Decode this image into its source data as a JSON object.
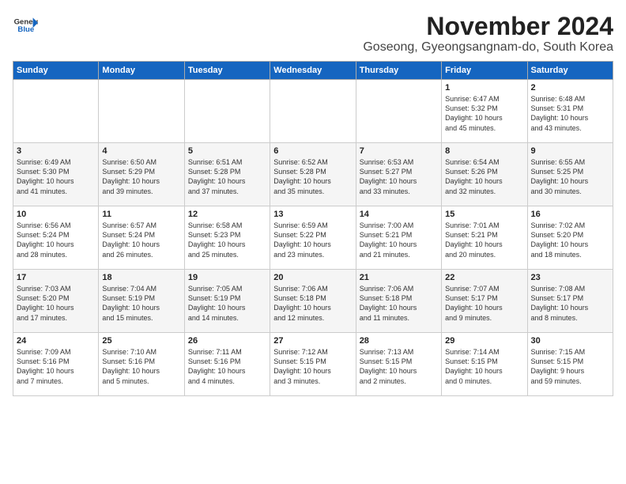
{
  "logo": {
    "line1": "General",
    "line2": "Blue"
  },
  "header": {
    "month": "November 2024",
    "location": "Goseong, Gyeongsangnam-do, South Korea"
  },
  "weekdays": [
    "Sunday",
    "Monday",
    "Tuesday",
    "Wednesday",
    "Thursday",
    "Friday",
    "Saturday"
  ],
  "weeks": [
    [
      {
        "day": "",
        "info": ""
      },
      {
        "day": "",
        "info": ""
      },
      {
        "day": "",
        "info": ""
      },
      {
        "day": "",
        "info": ""
      },
      {
        "day": "",
        "info": ""
      },
      {
        "day": "1",
        "info": "Sunrise: 6:47 AM\nSunset: 5:32 PM\nDaylight: 10 hours\nand 45 minutes."
      },
      {
        "day": "2",
        "info": "Sunrise: 6:48 AM\nSunset: 5:31 PM\nDaylight: 10 hours\nand 43 minutes."
      }
    ],
    [
      {
        "day": "3",
        "info": "Sunrise: 6:49 AM\nSunset: 5:30 PM\nDaylight: 10 hours\nand 41 minutes."
      },
      {
        "day": "4",
        "info": "Sunrise: 6:50 AM\nSunset: 5:29 PM\nDaylight: 10 hours\nand 39 minutes."
      },
      {
        "day": "5",
        "info": "Sunrise: 6:51 AM\nSunset: 5:28 PM\nDaylight: 10 hours\nand 37 minutes."
      },
      {
        "day": "6",
        "info": "Sunrise: 6:52 AM\nSunset: 5:28 PM\nDaylight: 10 hours\nand 35 minutes."
      },
      {
        "day": "7",
        "info": "Sunrise: 6:53 AM\nSunset: 5:27 PM\nDaylight: 10 hours\nand 33 minutes."
      },
      {
        "day": "8",
        "info": "Sunrise: 6:54 AM\nSunset: 5:26 PM\nDaylight: 10 hours\nand 32 minutes."
      },
      {
        "day": "9",
        "info": "Sunrise: 6:55 AM\nSunset: 5:25 PM\nDaylight: 10 hours\nand 30 minutes."
      }
    ],
    [
      {
        "day": "10",
        "info": "Sunrise: 6:56 AM\nSunset: 5:24 PM\nDaylight: 10 hours\nand 28 minutes."
      },
      {
        "day": "11",
        "info": "Sunrise: 6:57 AM\nSunset: 5:24 PM\nDaylight: 10 hours\nand 26 minutes."
      },
      {
        "day": "12",
        "info": "Sunrise: 6:58 AM\nSunset: 5:23 PM\nDaylight: 10 hours\nand 25 minutes."
      },
      {
        "day": "13",
        "info": "Sunrise: 6:59 AM\nSunset: 5:22 PM\nDaylight: 10 hours\nand 23 minutes."
      },
      {
        "day": "14",
        "info": "Sunrise: 7:00 AM\nSunset: 5:21 PM\nDaylight: 10 hours\nand 21 minutes."
      },
      {
        "day": "15",
        "info": "Sunrise: 7:01 AM\nSunset: 5:21 PM\nDaylight: 10 hours\nand 20 minutes."
      },
      {
        "day": "16",
        "info": "Sunrise: 7:02 AM\nSunset: 5:20 PM\nDaylight: 10 hours\nand 18 minutes."
      }
    ],
    [
      {
        "day": "17",
        "info": "Sunrise: 7:03 AM\nSunset: 5:20 PM\nDaylight: 10 hours\nand 17 minutes."
      },
      {
        "day": "18",
        "info": "Sunrise: 7:04 AM\nSunset: 5:19 PM\nDaylight: 10 hours\nand 15 minutes."
      },
      {
        "day": "19",
        "info": "Sunrise: 7:05 AM\nSunset: 5:19 PM\nDaylight: 10 hours\nand 14 minutes."
      },
      {
        "day": "20",
        "info": "Sunrise: 7:06 AM\nSunset: 5:18 PM\nDaylight: 10 hours\nand 12 minutes."
      },
      {
        "day": "21",
        "info": "Sunrise: 7:06 AM\nSunset: 5:18 PM\nDaylight: 10 hours\nand 11 minutes."
      },
      {
        "day": "22",
        "info": "Sunrise: 7:07 AM\nSunset: 5:17 PM\nDaylight: 10 hours\nand 9 minutes."
      },
      {
        "day": "23",
        "info": "Sunrise: 7:08 AM\nSunset: 5:17 PM\nDaylight: 10 hours\nand 8 minutes."
      }
    ],
    [
      {
        "day": "24",
        "info": "Sunrise: 7:09 AM\nSunset: 5:16 PM\nDaylight: 10 hours\nand 7 minutes."
      },
      {
        "day": "25",
        "info": "Sunrise: 7:10 AM\nSunset: 5:16 PM\nDaylight: 10 hours\nand 5 minutes."
      },
      {
        "day": "26",
        "info": "Sunrise: 7:11 AM\nSunset: 5:16 PM\nDaylight: 10 hours\nand 4 minutes."
      },
      {
        "day": "27",
        "info": "Sunrise: 7:12 AM\nSunset: 5:15 PM\nDaylight: 10 hours\nand 3 minutes."
      },
      {
        "day": "28",
        "info": "Sunrise: 7:13 AM\nSunset: 5:15 PM\nDaylight: 10 hours\nand 2 minutes."
      },
      {
        "day": "29",
        "info": "Sunrise: 7:14 AM\nSunset: 5:15 PM\nDaylight: 10 hours\nand 0 minutes."
      },
      {
        "day": "30",
        "info": "Sunrise: 7:15 AM\nSunset: 5:15 PM\nDaylight: 9 hours\nand 59 minutes."
      }
    ]
  ]
}
